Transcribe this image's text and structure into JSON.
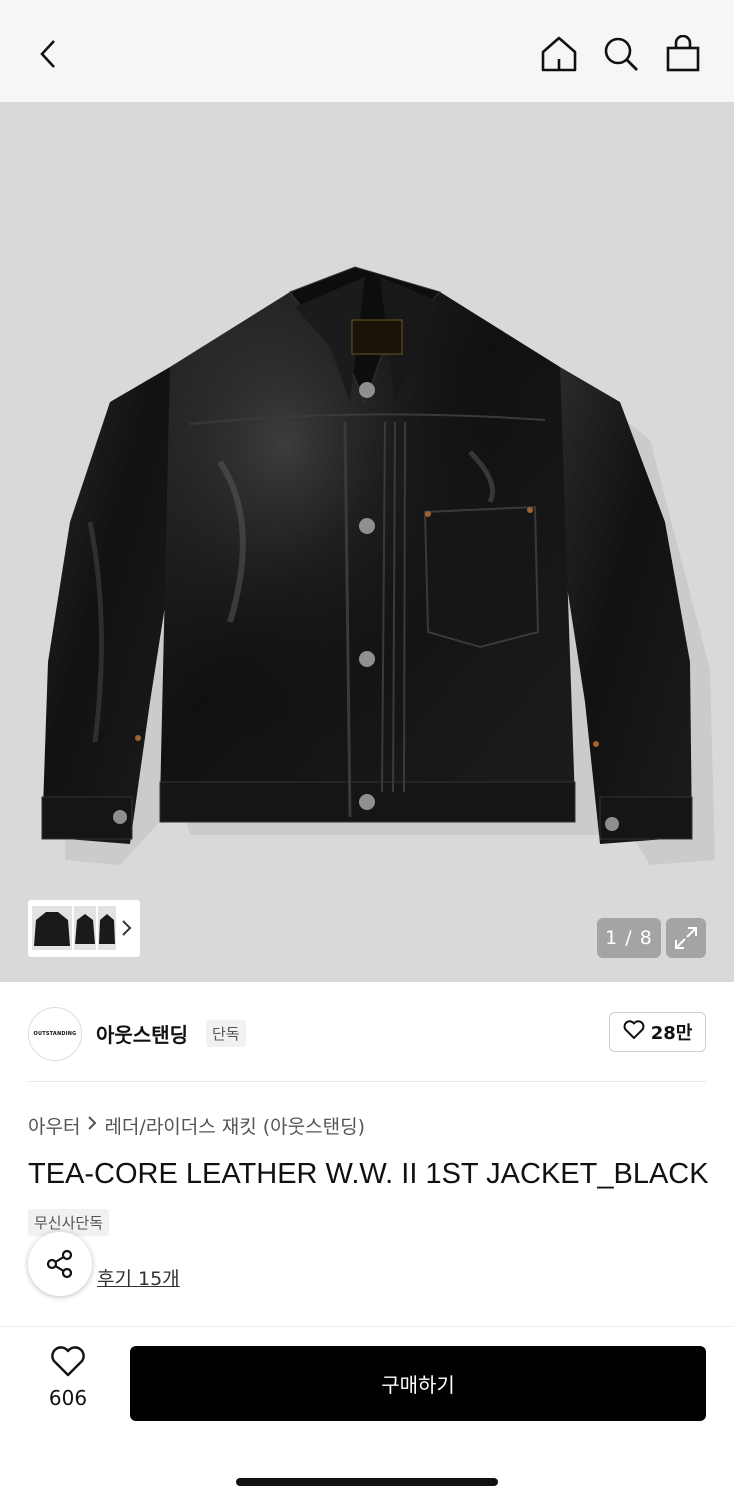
{
  "header": {
    "back_icon": "chevron-left-icon",
    "home_icon": "home-icon",
    "search_icon": "search-icon",
    "cart_icon": "shopping-bag-icon"
  },
  "gallery": {
    "current": 1,
    "total": 8,
    "pager_text": "1 / 8",
    "background_color": "#d9d9da"
  },
  "brand": {
    "logo_text": "OUTSTANDING",
    "name": "아웃스탠딩",
    "tag": "단독",
    "likes": "28만"
  },
  "breadcrumb": {
    "category": "아우터",
    "subcategory": "레더/라이더스 재킷 (아웃스탠딩)"
  },
  "product": {
    "title": "TEA-CORE LEATHER W.W. II 1ST JACKET_BLACK",
    "badge": "무신사단독",
    "reviews": "후기 15개"
  },
  "bottom": {
    "wish_count": "606",
    "buy_label": "구매하기"
  }
}
